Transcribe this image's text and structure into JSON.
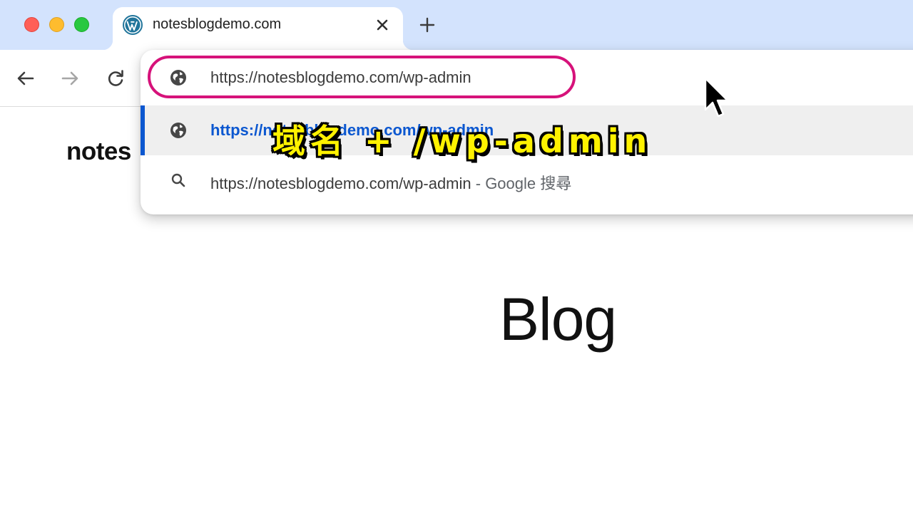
{
  "window": {
    "traffic_lights": [
      "close",
      "minimize",
      "zoom"
    ]
  },
  "tab": {
    "favicon": "wordpress-icon",
    "title": "notesblogdemo.com",
    "close_icon": "close-icon"
  },
  "toolbar": {
    "back_icon": "arrow-left-icon",
    "forward_icon": "arrow-right-icon",
    "reload_icon": "reload-icon",
    "new_tab_icon": "plus-icon"
  },
  "omnibox": {
    "input_value": "https://notesblogdemo.com/wp-admin",
    "input_icon": "globe-icon",
    "highlight_color": "#d6127a",
    "suggestions": [
      {
        "icon": "globe-icon",
        "text": "https://notesblogdemo.com/wp-admin",
        "selected": true
      },
      {
        "icon": "search-icon",
        "text": "https://notesblogdemo.com/wp-admin",
        "suffix": " - Google 搜尋",
        "selected": false
      }
    ]
  },
  "caption": {
    "text": "域名 + /wp-admin",
    "color": "#fff200"
  },
  "page": {
    "site_logo": "notes",
    "heading": "Blog"
  },
  "colors": {
    "tabstrip": "#d3e3fd",
    "accent_blue": "#0b57d0"
  }
}
